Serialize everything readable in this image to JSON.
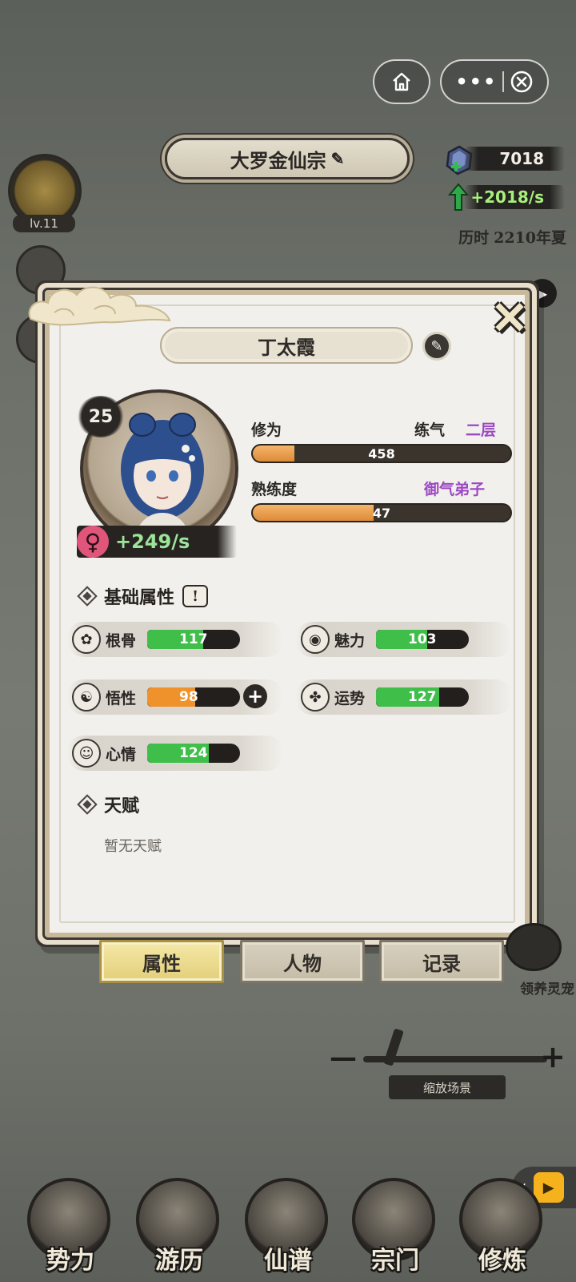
{
  "header": {
    "sect_name": "大罗金仙宗",
    "home_icon": "home-icon",
    "menu_icon": "more-dots-icon",
    "close_icon": "close-circle-icon"
  },
  "resources": {
    "spirit_stones": "7018",
    "rate": "+2018/s",
    "era_prefix": "历时",
    "era_value": "2210年夏"
  },
  "player": {
    "level": "lv.11"
  },
  "character": {
    "name": "丁太霞",
    "age": "25",
    "gender_icon": "female-icon",
    "cultivation_rate": "+249/s",
    "cultivation": {
      "label": "修为",
      "realm": "练气",
      "stage": "二层",
      "value": "458",
      "progress": 0.16
    },
    "proficiency": {
      "label": "熟练度",
      "rank": "御气弟子",
      "value": "47",
      "progress": 0.47
    }
  },
  "basic_attributes": {
    "title": "基础属性",
    "items": [
      {
        "name": "根骨",
        "value": "117",
        "fill": 0.6,
        "color": "#3fbf4a",
        "icon": "bone-icon"
      },
      {
        "name": "魅力",
        "value": "103",
        "fill": 0.55,
        "color": "#3fbf4a",
        "icon": "charm-eye-icon"
      },
      {
        "name": "悟性",
        "value": "98",
        "fill": 0.52,
        "color": "#f0922b",
        "icon": "meditate-icon"
      },
      {
        "name": "运势",
        "value": "127",
        "fill": 0.68,
        "color": "#3fbf4a",
        "icon": "clover-icon"
      },
      {
        "name": "心情",
        "value": "124",
        "fill": 0.66,
        "color": "#3fbf4a",
        "icon": "smile-icon"
      }
    ]
  },
  "talent": {
    "title": "天赋",
    "text": "暂无天赋"
  },
  "panel_tabs": [
    {
      "label": "属性",
      "active": true
    },
    {
      "label": "人物",
      "active": false
    },
    {
      "label": "记录",
      "active": false
    }
  ],
  "scene": {
    "pet_label": "领养灵宠",
    "zoom_label": "缩放场景",
    "zoom_minus": "—",
    "zoom_plus": "+"
  },
  "bottom_nav": [
    {
      "label": "势力",
      "icon": "faction-icon"
    },
    {
      "label": "游历",
      "icon": "mountain-icon"
    },
    {
      "label": "仙谱",
      "icon": "scroll-icon"
    },
    {
      "label": "宗门",
      "icon": "temple-icon"
    },
    {
      "label": "修炼",
      "icon": "yin-yang-icon"
    }
  ]
}
